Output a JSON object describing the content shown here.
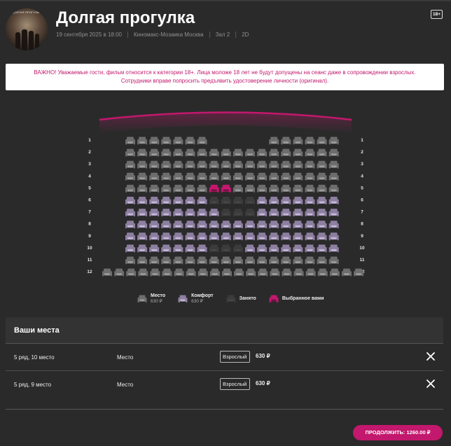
{
  "movie": {
    "title": "Долгая прогулка",
    "poster_text": "ДОЛГАЯ ПРОГУЛКА",
    "datetime": "19 сентября 2025 в 18:00",
    "cinema": "Киномакс-Мозаика Москва",
    "hall": "Зал 2",
    "format": "2D",
    "age_rating": "18+"
  },
  "notice": {
    "line1": "ВАЖНО! Уважаемые гости, фильм относится к категории 18+. Лица моложе 18 лет не будут допущены на сеанс даже в сопровождении взрослых.",
    "line2": "Сотрудники вправе попросить предъявить удостоверение личности (оригинал)."
  },
  "seat_map": {
    "colors": {
      "standard": "#6e6d6e",
      "standard_light": "#9a999a",
      "comfort": "#8d7fa0",
      "comfort_light": "#c2b5d6",
      "occupied": "#3c3b3c",
      "selected": "#c2186d",
      "screen": "#c2186d"
    },
    "rows": [
      {
        "label": "1",
        "seats": [
          "S",
          "S",
          "S",
          "S",
          "S",
          "S",
          "S",
          "",
          "",
          "",
          "",
          "",
          "S",
          "S",
          "S",
          "S",
          "S",
          "S"
        ]
      },
      {
        "label": "2",
        "seats": [
          "S",
          "S",
          "S",
          "S",
          "S",
          "S",
          "S",
          "S",
          "S",
          "S",
          "S",
          "S",
          "S",
          "S",
          "S",
          "S",
          "S",
          "S"
        ]
      },
      {
        "label": "3",
        "seats": [
          "S",
          "S",
          "S",
          "S",
          "S",
          "S",
          "S",
          "S",
          "S",
          "S",
          "S",
          "S",
          "S",
          "S",
          "S",
          "S",
          "S",
          "S"
        ]
      },
      {
        "label": "4",
        "seats": [
          "S",
          "S",
          "S",
          "S",
          "S",
          "S",
          "S",
          "S",
          "S",
          "S",
          "S",
          "S",
          "S",
          "S",
          "S",
          "S",
          "S",
          "S"
        ]
      },
      {
        "label": "5",
        "seats": [
          "S",
          "S",
          "S",
          "S",
          "S",
          "S",
          "S",
          "X",
          "X",
          "X",
          "X",
          "S",
          "S",
          "S",
          "S",
          "S",
          "S",
          "S"
        ],
        "selected": [
          7,
          8
        ]
      },
      {
        "label": "6",
        "seats": [
          "C",
          "C",
          "C",
          "C",
          "C",
          "C",
          "C",
          "O",
          "O",
          "O",
          "O",
          "C",
          "C",
          "C",
          "C",
          "C",
          "C",
          "C"
        ]
      },
      {
        "label": "7",
        "seats": [
          "C",
          "C",
          "C",
          "C",
          "C",
          "C",
          "C",
          "C",
          "O",
          "O",
          "O",
          "C",
          "C",
          "C",
          "C",
          "C",
          "C",
          "C"
        ]
      },
      {
        "label": "8",
        "seats": [
          "C",
          "C",
          "C",
          "C",
          "C",
          "C",
          "C",
          "C",
          "C",
          "C",
          "C",
          "C",
          "C",
          "C",
          "C",
          "C",
          "C",
          "C"
        ]
      },
      {
        "label": "9",
        "seats": [
          "C",
          "C",
          "C",
          "C",
          "C",
          "C",
          "C",
          "C",
          "C",
          "C",
          "C",
          "C",
          "C",
          "C",
          "C",
          "C",
          "C",
          "C"
        ]
      },
      {
        "label": "10",
        "seats": [
          "C",
          "C",
          "C",
          "C",
          "C",
          "C",
          "C",
          "O",
          "O",
          "O",
          "C",
          "C",
          "C",
          "C",
          "C",
          "C",
          "C",
          "C"
        ]
      },
      {
        "label": "11",
        "seats": [
          "S",
          "S",
          "S",
          "S",
          "S",
          "S",
          "S",
          "S",
          "S",
          "S",
          "S",
          "S",
          "S",
          "S",
          "S",
          "S",
          "S",
          "S"
        ]
      },
      {
        "label": "12",
        "seats": [
          "S",
          "S",
          "S",
          "S",
          "S",
          "S",
          "S",
          "S",
          "S",
          "S",
          "S",
          "S",
          "S",
          "S",
          "S",
          "S",
          "S",
          "S",
          "S",
          "S",
          "S",
          "S"
        ]
      }
    ]
  },
  "legend": {
    "standard_label": "Место",
    "standard_price": "630 ₽",
    "comfort_label": "Комфорт",
    "comfort_price": "630 ₽",
    "occupied_label": "Занято",
    "selected_label": "Выбранное вами"
  },
  "selection": {
    "heading": "Ваши места",
    "items": [
      {
        "seat": "5 ряд, 10 место",
        "type": "Место",
        "ticket": "Взрослый",
        "price": "630 ₽"
      },
      {
        "seat": "5 ряд, 9 место",
        "type": "Место",
        "ticket": "Взрослый",
        "price": "630 ₽"
      }
    ]
  },
  "cta": {
    "label": "ПРОДОЛЖИТЬ: 1260.00 ₽"
  }
}
